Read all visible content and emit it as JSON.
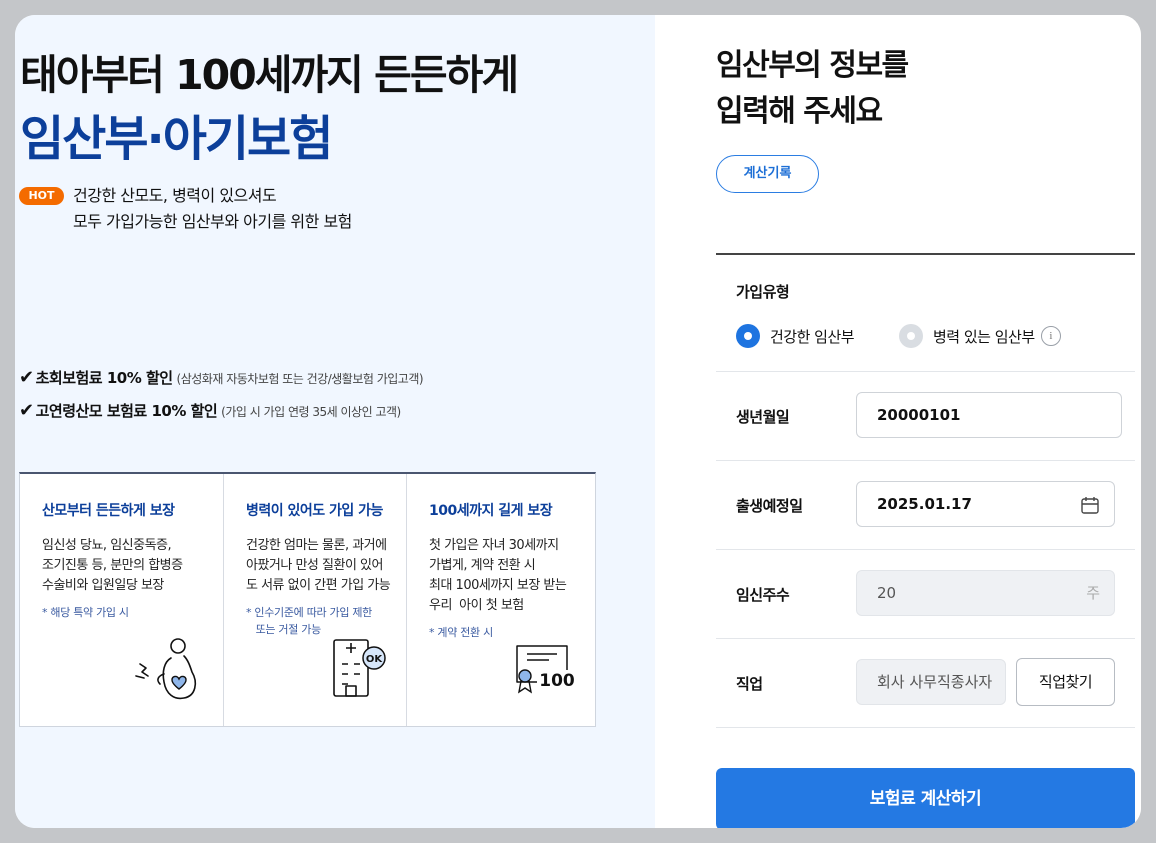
{
  "hero": {
    "line1": "태아부터 100세까지 든든하게",
    "line2": "임산부·아기보험",
    "badge": "HOT",
    "desc_line1": "건강한 산모도, 병력이 있으셔도",
    "desc_line2": "모두 가입가능한 임산부와 아기를 위한 보험"
  },
  "benefits": [
    {
      "main": "초회보험료 10% 할인",
      "sub": "(삼성화재 자동차보험 또는 건강/생활보험 가입고객)"
    },
    {
      "main": "고연령산모 보험료 10% 할인",
      "sub": "(가입 시 가입 연령 35세 이상인 고객)"
    }
  ],
  "features": [
    {
      "title": "산모부터 든든하게 보장",
      "desc": [
        "임신성 당뇨, 임신중독증,",
        "조기진통 등, 분만의 합병증",
        "수술비와 입원일당 보장"
      ],
      "note": [
        "* 해당 특약 가입 시"
      ],
      "icon": "pregnant-heart-icon"
    },
    {
      "title": "병력이 있어도 가입 가능",
      "desc": [
        "건강한 엄마는 물론, 과거에",
        "아팠거나 만성 질환이 있어",
        "도 서류 없이 간편 가입 가능"
      ],
      "note": [
        "* 인수기준에 따라 가입 제한",
        "   또는 거절 가능"
      ],
      "icon": "hospital-ok-icon",
      "icon_text": "OK"
    },
    {
      "title": "100세까지 길게 보장",
      "desc": [
        "첫 가입은 자녀 30세까지",
        "가볍게, 계약 전환 시",
        "최대 100세까지 보장 받는",
        "우리  아이 첫 보험"
      ],
      "note": [
        "* 계약 전환 시"
      ],
      "icon": "certificate-100-icon",
      "icon_text": "100"
    }
  ],
  "form": {
    "title_line1": "임산부의 정보를",
    "title_line2": "입력해 주세요",
    "history_button": "계산기록",
    "join_type_label": "가입유형",
    "radio_healthy": "건강한 임산부",
    "radio_history": "병력 있는 임산부",
    "radio_selected": "healthy",
    "info_glyph": "i",
    "birth_label": "생년월일",
    "birth_value": "20000101",
    "due_label": "출생예정일",
    "due_value": "2025.01.17",
    "weeks_label": "임신주수",
    "weeks_value": "20",
    "weeks_suffix": "주",
    "job_label": "직업",
    "job_value": "회사 사무직종사자",
    "job_button": "직업찾기",
    "submit_button": "보험료 계산하기"
  },
  "colors": {
    "accent": "#2479e3",
    "brand_navy": "#0c3f9a",
    "hot": "#f46b00",
    "left_bg": "#f1f7ff"
  }
}
